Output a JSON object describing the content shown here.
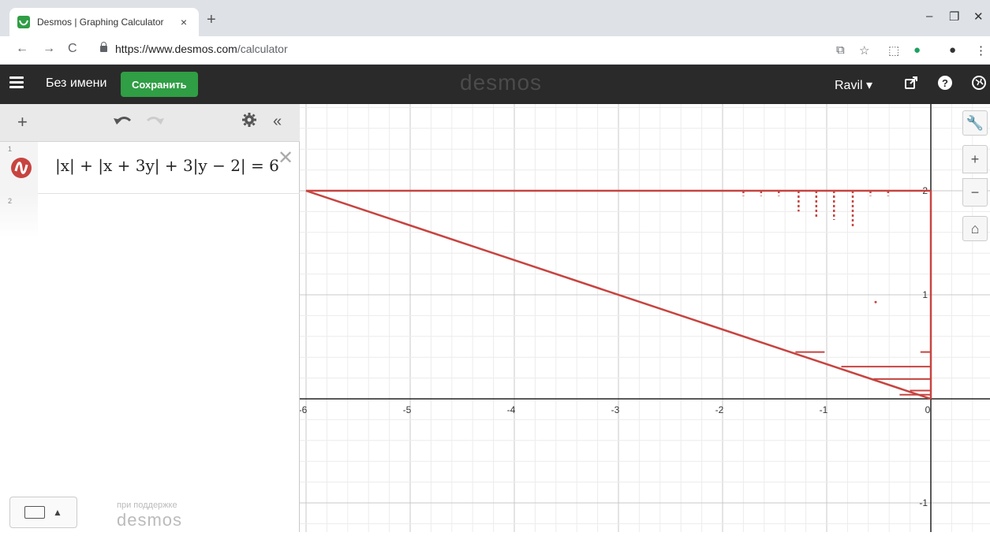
{
  "browser": {
    "tab_title": "Desmos | Graphing Calculator",
    "tab_close": "×",
    "new_tab": "+",
    "url_host": "https://www.desmos.com",
    "url_path": "/calculator",
    "window_controls": [
      "–",
      "❐",
      "✕"
    ]
  },
  "header": {
    "menu_icon": "hamburger-icon",
    "doc_title": "Без имени",
    "save_label": "Сохранить",
    "logo": "desmos",
    "user": "Ravil ▾",
    "accent_color": "#2f9e44",
    "bg_color": "#2a2a2a"
  },
  "expressions": {
    "items": [
      {
        "index": "1",
        "latex_text": "|x| + |x + 3y| + 3|y − 2| = 6",
        "color": "#c74440"
      },
      {
        "index": "2",
        "latex_text": ""
      }
    ]
  },
  "footer": {
    "powered_by": "при поддержке",
    "powered_logo": "desmos"
  },
  "graph": {
    "x_ticks": [
      "-6",
      "-5",
      "-4",
      "-3",
      "-2",
      "-1",
      "0"
    ],
    "y_ticks": [
      "2",
      "1",
      "-1"
    ],
    "curve_color": "#c74440"
  }
}
